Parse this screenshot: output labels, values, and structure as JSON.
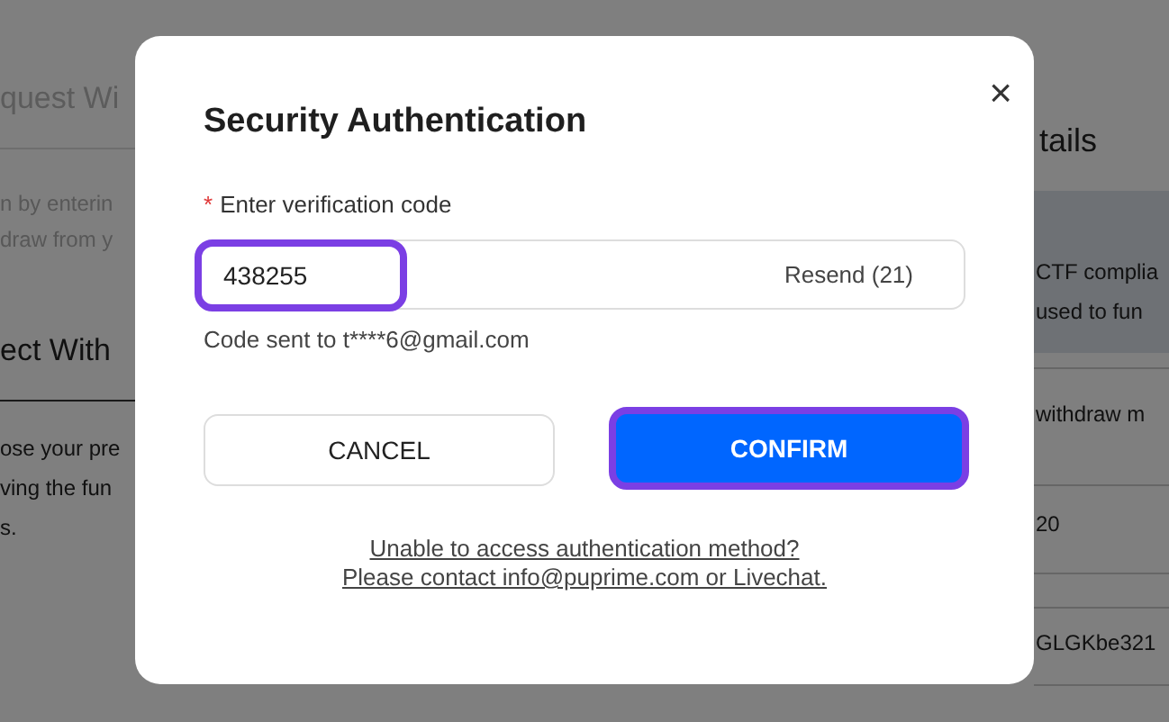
{
  "background_page": {
    "left_column": {
      "heading": "quest Wi",
      "intro_lines": [
        "n by enterin",
        "draw from y"
      ],
      "section_heading": "ect With",
      "section_lines": [
        "ose your pre",
        "ving the fun",
        "s."
      ]
    },
    "right_column": {
      "heading": "tails",
      "notice_lines": [
        "CTF complia",
        "used to fun"
      ],
      "rows": [
        "withdraw m",
        "20",
        "GLGKbe321"
      ]
    }
  },
  "dialog": {
    "title": "Security Authentication",
    "close": "×",
    "code_field": {
      "required_mark": "*",
      "label": "Enter verification code",
      "value": "438255",
      "highlighted": true,
      "resend": "Resend (21)",
      "hint": "Code sent to t****6@gmail.com"
    },
    "buttons": [
      {
        "kind": "secondary",
        "label": "CANCEL",
        "highlighted": false
      },
      {
        "kind": "primary",
        "label": "CONFIRM",
        "highlighted": true
      }
    ],
    "help_links": [
      "Unable to access authentication method?",
      "Please contact info@puprime.com or Livechat."
    ]
  }
}
